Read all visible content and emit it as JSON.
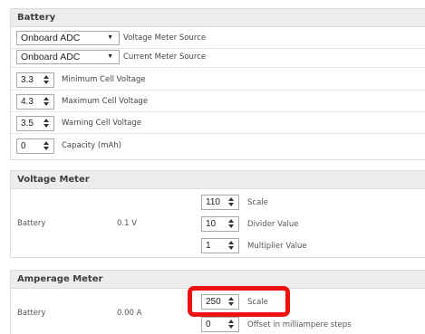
{
  "battery": {
    "title": "Battery",
    "voltage_source": {
      "value": "Onboard ADC",
      "label": "Voltage Meter Source"
    },
    "current_source": {
      "value": "Onboard ADC",
      "label": "Current Meter Source"
    },
    "min_cell": {
      "value": "3.3",
      "label": "Minimum Cell Voltage"
    },
    "max_cell": {
      "value": "4.3",
      "label": "Maximum Cell Voltage"
    },
    "warn_cell": {
      "value": "3.5",
      "label": "Warning Cell Voltage"
    },
    "capacity": {
      "value": "0",
      "label": "Capacity (mAh)"
    }
  },
  "voltage_meter": {
    "title": "Voltage Meter",
    "source_label": "Battery",
    "reading": "0.1 V",
    "scale": {
      "value": "110",
      "label": "Scale"
    },
    "divider": {
      "value": "10",
      "label": "Divider Value"
    },
    "multiplier": {
      "value": "1",
      "label": "Multiplier Value"
    }
  },
  "amperage_meter": {
    "title": "Amperage Meter",
    "source_label": "Battery",
    "reading": "0.00 A",
    "scale": {
      "value": "250",
      "label": "Scale"
    },
    "offset": {
      "value": "0",
      "label": "Offset in milliampere steps"
    }
  },
  "colors": {
    "highlight": "#ee1111",
    "header_bg": "#ececec"
  }
}
